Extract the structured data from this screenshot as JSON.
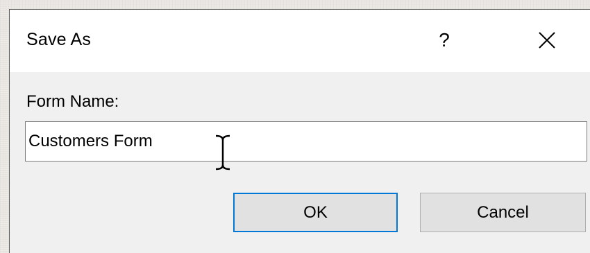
{
  "dialog": {
    "title": "Save As",
    "help_glyph": "?",
    "close_icon": "close-icon"
  },
  "form": {
    "label": "Form Name:",
    "value": "Customers Form"
  },
  "buttons": {
    "ok_label": "OK",
    "cancel_label": "Cancel"
  },
  "colors": {
    "accent": "#0078d7",
    "title_bar": "#ffffff",
    "dialog_bg": "#f0f0f0",
    "button_bg": "#e1e1e1"
  },
  "cursor": "i-beam-cursor-icon"
}
